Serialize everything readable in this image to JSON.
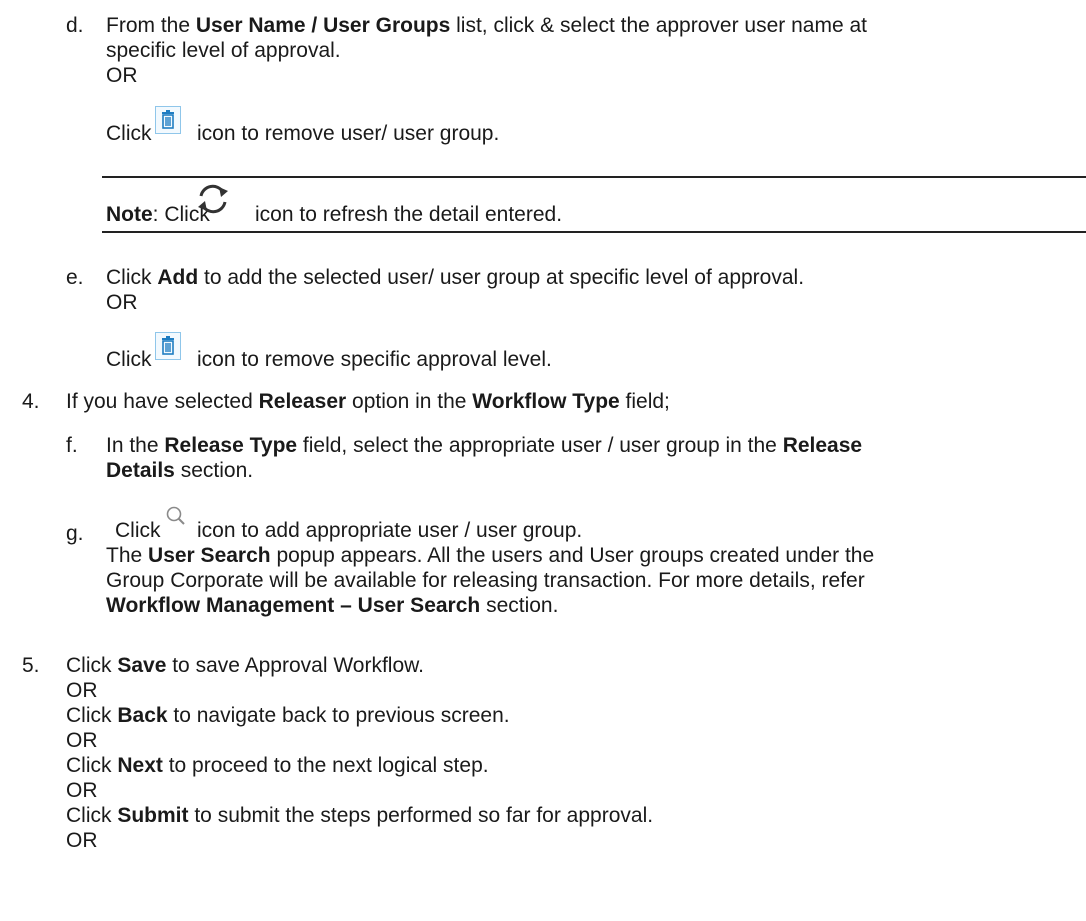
{
  "step3": {
    "d": {
      "marker": "d.",
      "t1": "From the ",
      "b1": "User Name / User Groups",
      "t2": " list, click & select the approver user name at",
      "line2": "specific level of approval.",
      "or": "OR",
      "click": "Click",
      "after_icon": "icon to remove user/ user group.",
      "icon": "trash-icon"
    },
    "note": {
      "label": "Note",
      "t1": ": Click",
      "after_icon": "icon to refresh the detail entered.",
      "icon": "refresh-icon"
    },
    "e": {
      "marker": "e.",
      "t1": "Click ",
      "b1": "Add",
      "t2": " to add the selected user/ user group at specific level of approval.",
      "or": "OR",
      "click": "Click",
      "after_icon": "icon to remove specific approval level.",
      "icon": "trash-icon"
    }
  },
  "step4": {
    "marker": "4.",
    "t1": "If you have selected ",
    "b1": "Releaser",
    "t2": " option in the ",
    "b2": "Workflow Type",
    "t3": " field;",
    "f": {
      "marker": "f.",
      "t1": "In the ",
      "b1": "Release Type",
      "t2": "  field, select the appropriate user / user group in the ",
      "b2": "Release",
      "b3": "Details",
      "t3": " section."
    },
    "g": {
      "marker": "g.",
      "click": "Click",
      "after_icon": "icon to add appropriate user / user group.",
      "icon": "search-icon",
      "l2_t1": "The ",
      "l2_b1": "User Search",
      "l2_t2": " popup appears. All the users and User groups created under the",
      "l3": "Group Corporate will be available for releasing transaction. For more details, refer",
      "l4_b1": "Workflow  Management – User Search",
      "l4_t2": " section."
    }
  },
  "step5": {
    "marker": "5.",
    "save_t1": "Click ",
    "save_b": "Save",
    "save_t2": " to save Approval Workflow.",
    "or": "OR",
    "back_t1": "Click ",
    "back_b": "Back",
    "back_t2": " to navigate back to previous screen.",
    "next_t1": "Click ",
    "next_b": "Next",
    "next_t2": " to proceed to the next logical step.",
    "submit_t1": "Click ",
    "submit_b": "Submit",
    "submit_t2": " to submit the steps performed so far for approval."
  }
}
